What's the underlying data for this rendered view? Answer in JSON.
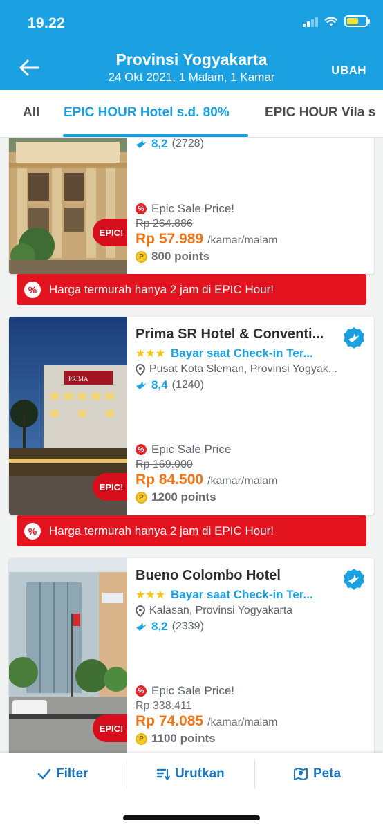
{
  "status_bar": {
    "time": "19.22"
  },
  "header": {
    "title": "Provinsi Yogyakarta",
    "subtitle": "24 Okt 2021, 1 Malam, 1 Kamar",
    "action": "UBAH"
  },
  "tabs": [
    {
      "label": "All"
    },
    {
      "label": "EPIC HOUR Hotel s.d. 80%"
    },
    {
      "label": "EPIC HOUR Vila s"
    }
  ],
  "hotels": [
    {
      "rating": "8,2",
      "reviews": "(2728)",
      "sale_label": "Epic Sale Price!",
      "old_price": "Rp 264.886",
      "price": "Rp 57.989",
      "per": "/kamar/malam",
      "points": "800 points",
      "epic_tag": "EPIC!"
    },
    {
      "name": "Prima SR Hotel & Conventi...",
      "pay_label": "Bayar saat Check-in Ter...",
      "location": "Pusat Kota Sleman, Provinsi Yogyak...",
      "rating": "8,4",
      "reviews": "(1240)",
      "sale_label": "Epic Sale Price",
      "old_price": "Rp 169.000",
      "price": "Rp 84.500",
      "per": "/kamar/malam",
      "points": "1200 points",
      "epic_tag": "EPIC!"
    },
    {
      "name": "Bueno Colombo Hotel",
      "pay_label": "Bayar saat Check-in Ter...",
      "location": "Kalasan, Provinsi Yogyakarta",
      "rating": "8,2",
      "reviews": "(2339)",
      "sale_label": "Epic Sale Price!",
      "old_price": "Rp 338.411",
      "price": "Rp 74.085",
      "per": "/kamar/malam",
      "points": "1100 points",
      "epic_tag": "EPIC!"
    }
  ],
  "promo_text": "Harga termurah hanya 2 jam di EPIC Hour!",
  "bottom_bar": {
    "filter": "Filter",
    "sort": "Urutkan",
    "map": "Peta"
  },
  "colors": {
    "brand_blue": "#1ba0e2",
    "price_orange": "#f27313",
    "promo_red": "#e3141f",
    "star_yellow": "#f8c300"
  },
  "icons": [
    "back-arrow-icon",
    "signal-icon",
    "wifi-icon",
    "battery-icon",
    "check-icon",
    "sort-icon",
    "map-icon",
    "location-pin-icon",
    "traveloka-bird-icon",
    "verified-badge-icon",
    "percent-icon",
    "points-coin-icon"
  ]
}
